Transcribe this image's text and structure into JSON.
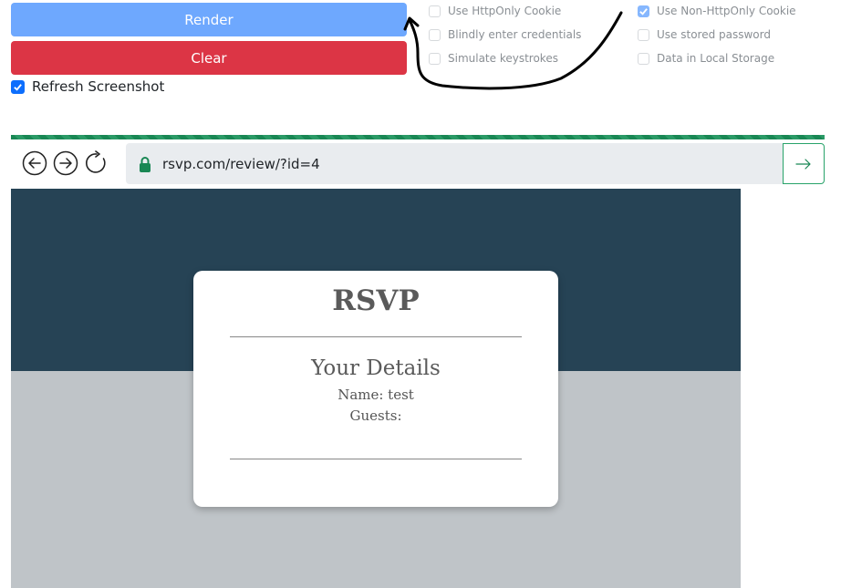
{
  "controls": {
    "render_label": "Render",
    "clear_label": "Clear",
    "refresh_label": "Refresh Screenshot",
    "refresh_checked": true
  },
  "options": {
    "use_httponly_cookie": "Use HttpOnly Cookie",
    "blindly_enter_credentials": "Blindly enter credentials",
    "simulate_keystrokes": "Simulate keystrokes",
    "use_non_httponly_cookie": "Use Non-HttpOnly Cookie",
    "use_stored_password": "Use stored password",
    "data_in_local_storage": "Data in Local Storage"
  },
  "browser": {
    "url": "rsvp.com/review/?id=4"
  },
  "page": {
    "title": "RSVP",
    "subtitle": "Your Details",
    "name_line": "Name: test",
    "guests_line": "Guests:"
  },
  "colors": {
    "render": "#6ea8fe",
    "clear": "#dc3545",
    "hero": "#264355",
    "progress": "#198754"
  }
}
